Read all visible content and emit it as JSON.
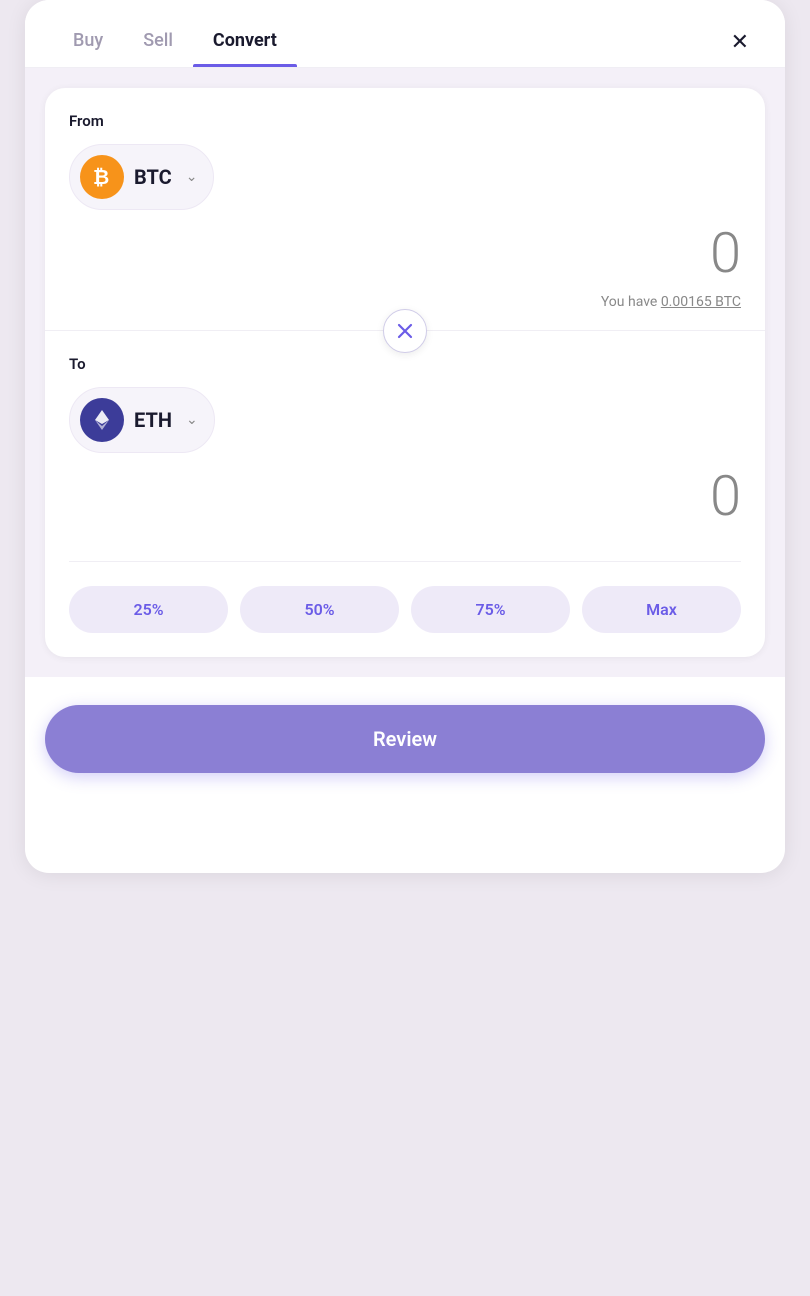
{
  "tabs": {
    "buy": {
      "label": "Buy",
      "active": false
    },
    "sell": {
      "label": "Sell",
      "active": false
    },
    "convert": {
      "label": "Convert",
      "active": true
    }
  },
  "close_button": "✕",
  "from_section": {
    "label": "From",
    "currency": {
      "symbol": "BTC",
      "icon_type": "btc"
    },
    "amount": "0",
    "balance_text": "You have",
    "balance_value": "0.00165 BTC"
  },
  "to_section": {
    "label": "To",
    "currency": {
      "symbol": "ETH",
      "icon_type": "eth"
    },
    "amount": "0"
  },
  "percentage_buttons": [
    {
      "label": "25%"
    },
    {
      "label": "50%"
    },
    {
      "label": "75%"
    },
    {
      "label": "Max"
    }
  ],
  "review_button": {
    "label": "Review"
  },
  "colors": {
    "accent": "#6b5ce7",
    "btc": "#f7931a",
    "eth": "#3c3c99"
  }
}
